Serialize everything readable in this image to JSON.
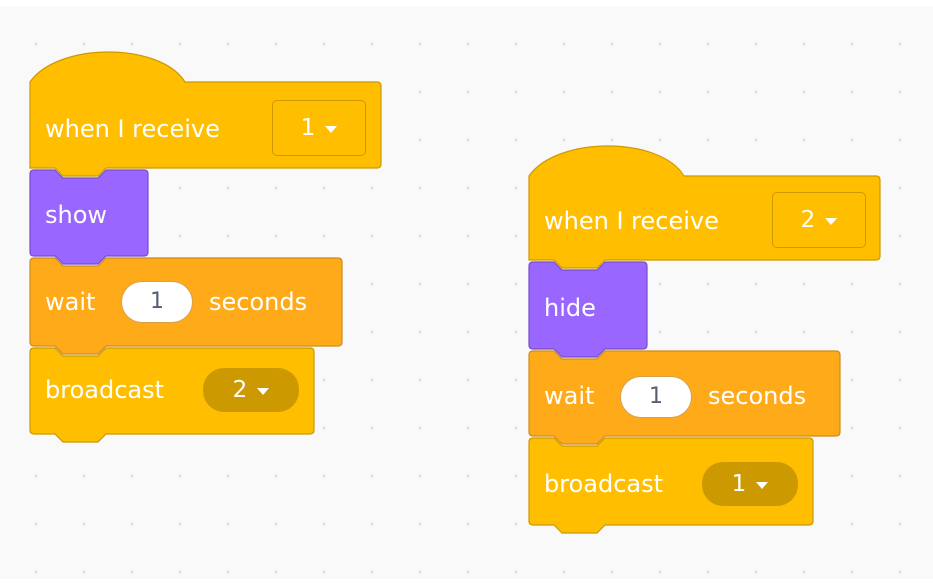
{
  "colors": {
    "events": "#ffbf00",
    "events_dark": "#cc9900",
    "looks": "#9966ff",
    "looks_dark": "#774dcb",
    "control": "#ffab19",
    "control_dark": "#cf8b17",
    "workspace": "#f9f9f9"
  },
  "scripts": [
    {
      "hat": {
        "label": "when I receive",
        "message": "1"
      },
      "looks": {
        "label": "show"
      },
      "wait": {
        "prefix": "wait",
        "value": "1",
        "suffix": "seconds"
      },
      "broadcast": {
        "label": "broadcast",
        "message": "2"
      }
    },
    {
      "hat": {
        "label": "when I receive",
        "message": "2"
      },
      "looks": {
        "label": "hide"
      },
      "wait": {
        "prefix": "wait",
        "value": "1",
        "suffix": "seconds"
      },
      "broadcast": {
        "label": "broadcast",
        "message": "1"
      }
    }
  ]
}
